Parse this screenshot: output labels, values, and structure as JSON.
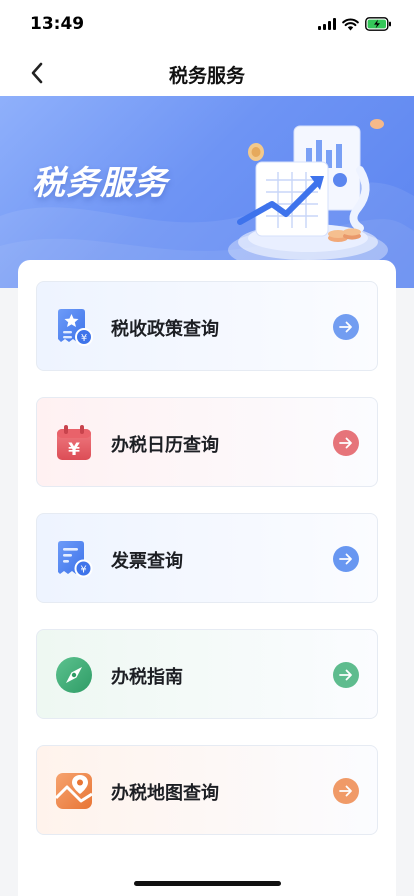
{
  "status_bar": {
    "time": "13:49"
  },
  "nav": {
    "title": "税务服务"
  },
  "banner": {
    "title": "税务服务"
  },
  "services": [
    {
      "label": "税收政策查询",
      "icon": "policy-document-icon",
      "accent": "#5b8def",
      "bg": "#eef4ff"
    },
    {
      "label": "办税日历查询",
      "icon": "calendar-icon",
      "accent": "#e35d64",
      "bg": "#fff1f2"
    },
    {
      "label": "发票查询",
      "icon": "invoice-icon",
      "accent": "#4f86ef",
      "bg": "#eef4ff"
    },
    {
      "label": "办税指南",
      "icon": "compass-icon",
      "accent": "#43b27b",
      "bg": "#eef8f2"
    },
    {
      "label": "办税地图查询",
      "icon": "map-icon",
      "accent": "#ef8a4e",
      "bg": "#fff3ec"
    }
  ]
}
